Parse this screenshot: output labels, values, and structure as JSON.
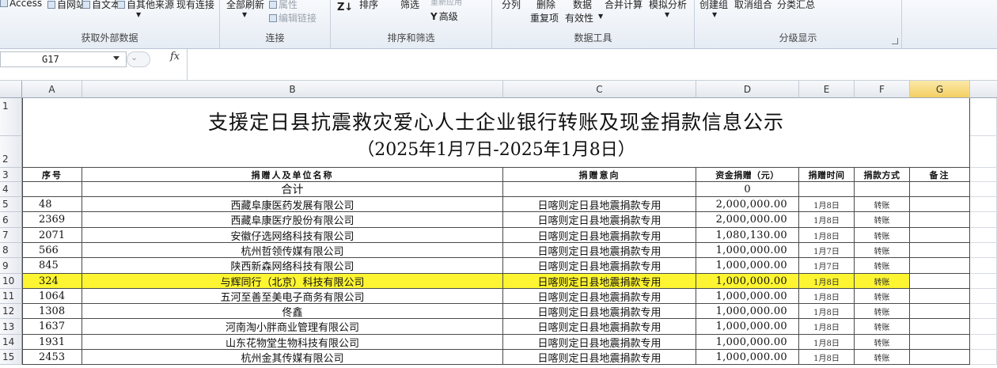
{
  "ribbon": {
    "external_data": {
      "access": "Access",
      "web": "自网站",
      "text": "自文本",
      "other": "自其他来源",
      "existing": "现有连接",
      "label": "获取外部数据"
    },
    "connections": {
      "refresh_all": "全部刷新",
      "properties": "属性",
      "edit_links": "编辑链接",
      "label": "连接"
    },
    "sort_filter": {
      "az": "Z↓",
      "sort": "排序",
      "filter": "筛选",
      "reapply": "重新应用",
      "advanced": "高级",
      "label": "排序和筛选"
    },
    "data_tools": {
      "split": "分列",
      "remove_dup": "删除",
      "dup_line2": "重复项",
      "validation": "数据",
      "validation2": "有效性",
      "consolidate": "合并计算",
      "whatif": "模拟分析",
      "label": "数据工具"
    },
    "outline": {
      "group": "创建组",
      "ungroup": "取消组合",
      "subtotal": "分类汇总",
      "label": "分级显示"
    }
  },
  "formula_bar": {
    "name_box": "G17",
    "fx": "fx",
    "value": ""
  },
  "columns": [
    "A",
    "B",
    "C",
    "D",
    "E",
    "F",
    "G"
  ],
  "selected_column": "G",
  "row_numbers": [
    "1",
    "2",
    "3",
    "4",
    "5",
    "6",
    "7",
    "8",
    "9",
    "10",
    "11",
    "12",
    "13",
    "14",
    "15"
  ],
  "sheet": {
    "title_line1": "支援定日县抗震救灾爱心人士企业银行转账及现金捐款信息公示",
    "title_line2": "（2025年1月7日-2025年1月8日）",
    "headers": [
      "序号",
      "捐赠人及单位名称",
      "捐赠意向",
      "资金捐赠（元）",
      "捐赠时间",
      "捐款方式",
      "备注"
    ],
    "total_row": {
      "label": "合计",
      "amount": "0"
    },
    "rows": [
      {
        "no": "48",
        "name": "西藏阜康医药发展有限公司",
        "intent": "日喀则定日县地震捐款专用",
        "amount": "2,000,000.00",
        "date": "1月8日",
        "method": "转账"
      },
      {
        "no": "2369",
        "name": "西藏阜康医疗股份有限公司",
        "intent": "日喀则定日县地震捐款专用",
        "amount": "2,000,000.00",
        "date": "1月8日",
        "method": "转账"
      },
      {
        "no": "2071",
        "name": "安徽仔选网络科技有限公司",
        "intent": "日喀则定日县地震捐款专用",
        "amount": "1,080,130.00",
        "date": "1月8日",
        "method": "转账"
      },
      {
        "no": "566",
        "name": "杭州哲领传媒有限公司",
        "intent": "日喀则定日县地震捐款专用",
        "amount": "1,000,000.00",
        "date": "1月7日",
        "method": "转账"
      },
      {
        "no": "845",
        "name": "陕西新森网络科技有限公司",
        "intent": "日喀则定日县地震捐款专用",
        "amount": "1,000,000.00",
        "date": "1月7日",
        "method": "转账"
      },
      {
        "no": "324",
        "name": "与辉同行（北京）科技有限公司",
        "intent": "日喀则定日县地震捐款专用",
        "amount": "1,000,000.00",
        "date": "1月8日",
        "method": "转账"
      },
      {
        "no": "1064",
        "name": "五河至善至美电子商务有限公司",
        "intent": "日喀则定日县地震捐款专用",
        "amount": "1,000,000.00",
        "date": "1月8日",
        "method": "转账"
      },
      {
        "no": "1308",
        "name": "佟鑫",
        "intent": "日喀则定日县地震捐款专用",
        "amount": "1,000,000.00",
        "date": "1月8日",
        "method": "转账"
      },
      {
        "no": "1637",
        "name": "河南淘小胖商业管理有限公司",
        "intent": "日喀则定日县地震捐款专用",
        "amount": "1,000,000.00",
        "date": "1月8日",
        "method": "转账"
      },
      {
        "no": "1931",
        "name": "山东花物堂生物科技有限公司",
        "intent": "日喀则定日县地震捐款专用",
        "amount": "1,000,000.00",
        "date": "1月8日",
        "method": "转账"
      },
      {
        "no": "2453",
        "name": "杭州金其传媒有限公司",
        "intent": "日喀则定日县地震捐款专用",
        "amount": "1,000,000.00",
        "date": "1月8日",
        "method": "转账"
      }
    ],
    "highlight_color": "#fdf531"
  }
}
